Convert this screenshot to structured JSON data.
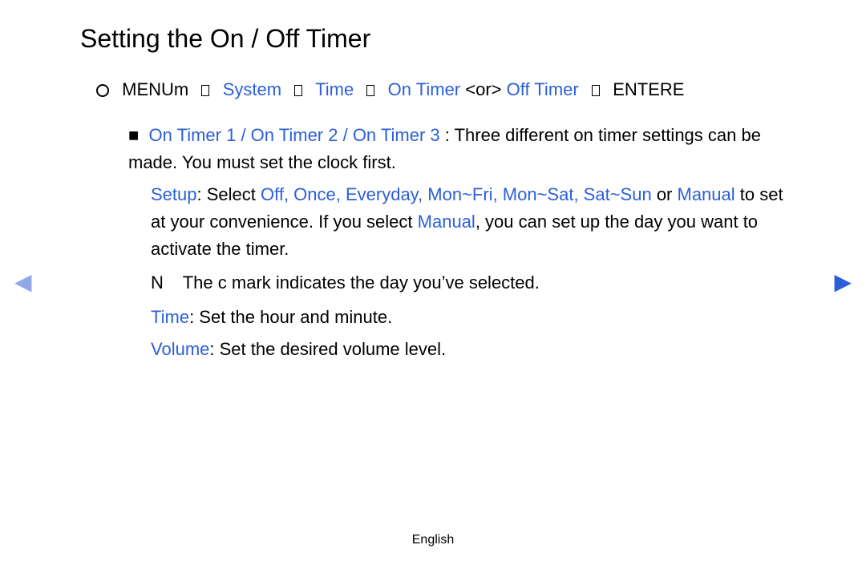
{
  "title": "Setting the On / Off Timer",
  "nav": {
    "marker": "O",
    "menu": "MENUm",
    "sep": "→",
    "system": "System",
    "time": "Time",
    "on_timer": "On Timer",
    "or_text": "<or>",
    "off_timer": "Off Timer",
    "enter": "ENTERE"
  },
  "bullet_marker": "■",
  "timer_names": "On Timer 1 / On Timer 2 / On Timer 3",
  "timer_desc": ": Three different on timer settings can be made. You must set the clock first.",
  "setup_label": "Setup",
  "setup_select": ": Select",
  "setup_options": "Off, Once, Everyday, Mon~Fri, Mon~Sat, Sat~Sun",
  "setup_or": " or ",
  "setup_manual1": "Manual",
  "setup_tail1": " to set at your convenience. If you select",
  "setup_manual2": "Manual",
  "setup_tail2": ", you can set up the day you want to activate the timer.",
  "note_marker": "N",
  "note_pre": "The",
  "note_check": "c",
  "note_post": " mark indicates the day you’ve selected.",
  "time_label": "Time",
  "time_desc": ": Set the hour and minute.",
  "volume_label": "Volume",
  "volume_desc": ": Set the desired volume level.",
  "footer": "English"
}
